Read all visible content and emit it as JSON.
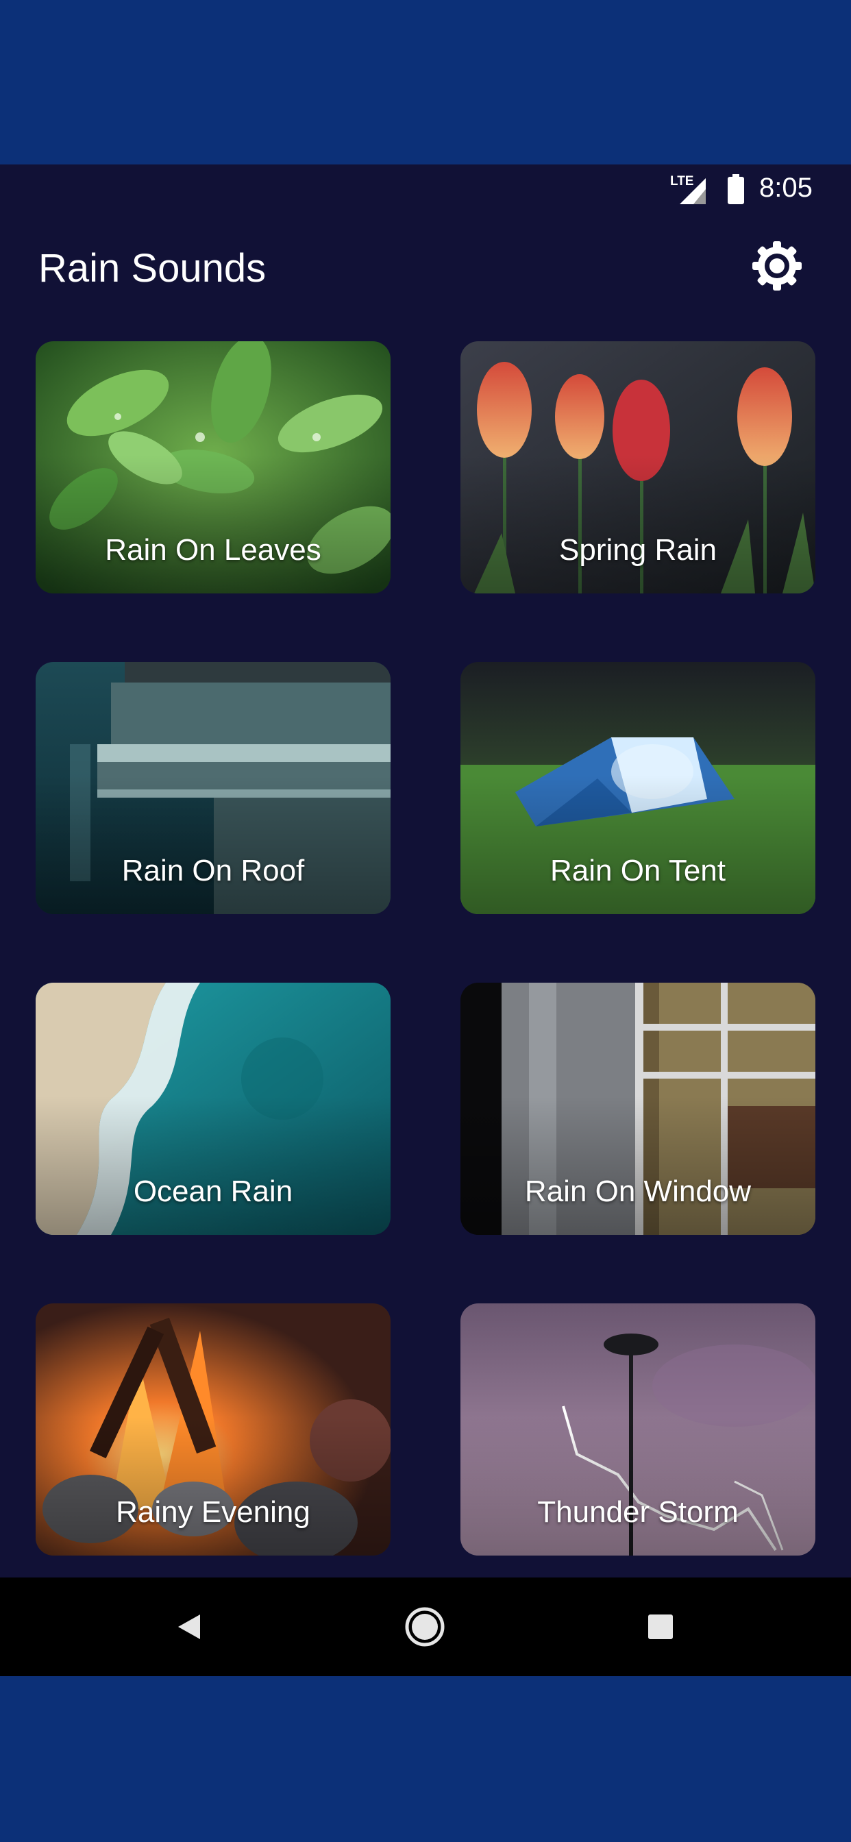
{
  "status_bar": {
    "network": "LTE",
    "time": "8:05"
  },
  "app": {
    "title": "Rain Sounds"
  },
  "sounds": [
    {
      "label": "Rain On Leaves"
    },
    {
      "label": "Spring Rain"
    },
    {
      "label": "Rain On Roof"
    },
    {
      "label": "Rain On Tent"
    },
    {
      "label": "Ocean Rain"
    },
    {
      "label": "Rain On Window"
    },
    {
      "label": "Rainy Evening"
    },
    {
      "label": "Thunder Storm"
    }
  ],
  "icons": {
    "settings": "gear-icon",
    "back": "back-triangle-icon",
    "home": "home-circle-icon",
    "recents": "recents-square-icon",
    "signal": "signal-icon",
    "battery": "battery-icon"
  },
  "colors": {
    "outer_background": "#0c3078",
    "app_background": "#111136",
    "nav_bar": "#000000",
    "text": "#ffffff"
  }
}
